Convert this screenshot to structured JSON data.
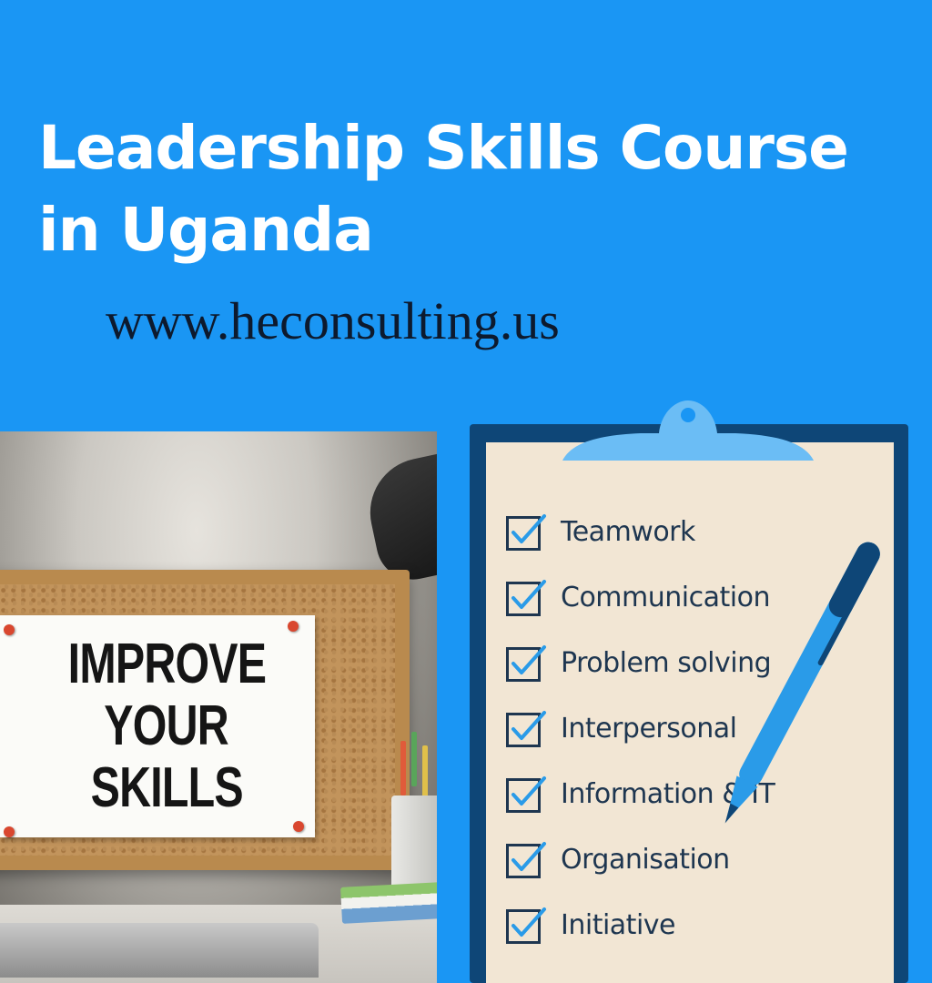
{
  "banner": {
    "title_line1": "Leadership Skills Course",
    "title_line2": "in Uganda",
    "website": "www.heconsulting.us"
  },
  "photo": {
    "sign_lines": [
      "IMPROVE",
      "YOUR",
      "SKILLS"
    ]
  },
  "checklist": {
    "items": [
      {
        "label": "Teamwork",
        "checked": true
      },
      {
        "label": "Communication",
        "checked": true
      },
      {
        "label": "Problem solving",
        "checked": true
      },
      {
        "label": "Interpersonal",
        "checked": true
      },
      {
        "label": "Information & IT",
        "checked": true
      },
      {
        "label": "Organisation",
        "checked": true
      },
      {
        "label": "Initiative",
        "checked": true
      }
    ]
  },
  "colors": {
    "background": "#1a96f4",
    "title_text": "#ffffff",
    "website_text": "#0d1a2e",
    "clipboard": "#0e4677",
    "paper": "#f2e6d4",
    "checkmark": "#2a9be8",
    "pen": "#2a9be8"
  },
  "icons": {
    "checkbox": "checkbox-checked-icon",
    "pen": "pen-icon",
    "clipboard_clip": "clip-icon"
  }
}
